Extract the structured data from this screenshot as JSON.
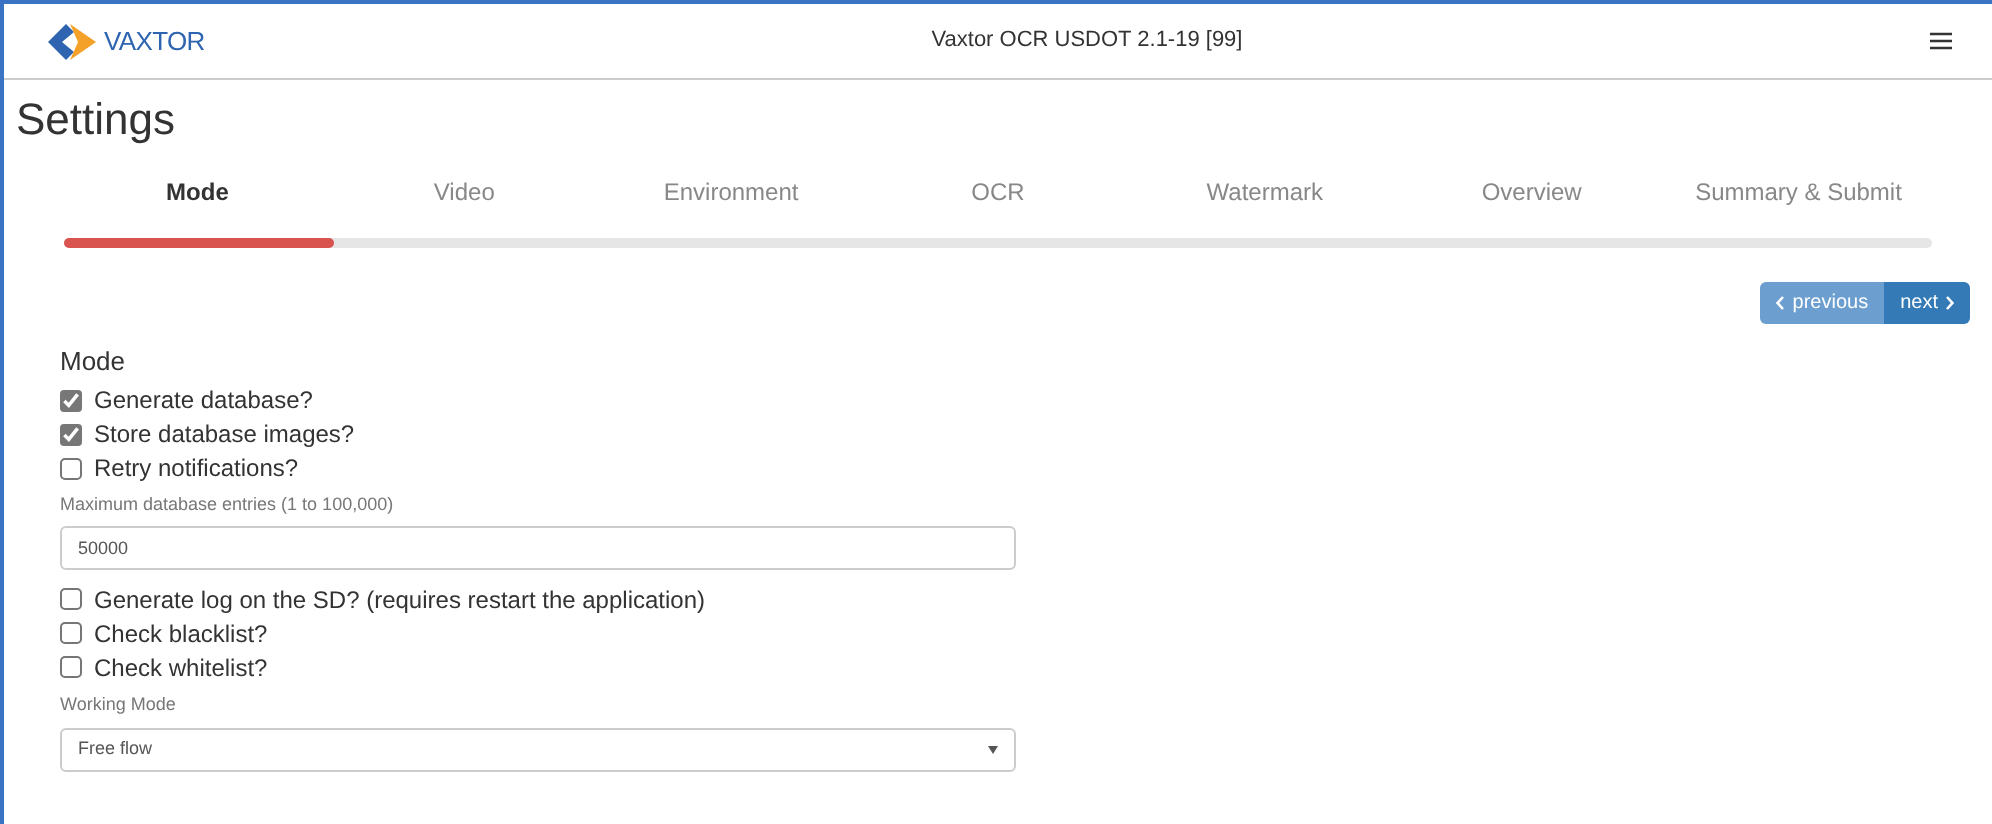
{
  "header": {
    "brand": "VAXTOR",
    "title": "Vaxtor OCR USDOT 2.1-19 [99]"
  },
  "page_title": "Settings",
  "steps": [
    {
      "label": "Mode",
      "selected": true
    },
    {
      "label": "Video",
      "selected": false
    },
    {
      "label": "Environment",
      "selected": false
    },
    {
      "label": "OCR",
      "selected": false
    },
    {
      "label": "Watermark",
      "selected": false
    },
    {
      "label": "Overview",
      "selected": false
    },
    {
      "label": "Summary & Submit",
      "selected": false
    }
  ],
  "progress": {
    "level": 0.145
  },
  "nav": {
    "previous": {
      "label": "previous",
      "disabled": true
    },
    "next": {
      "label": "next",
      "disabled": false
    }
  },
  "section": "Mode",
  "fields": [
    {
      "kind": "checkbox",
      "label": "Generate database?",
      "checked": true
    },
    {
      "kind": "checkbox",
      "label": "Store database images?",
      "checked": true
    },
    {
      "kind": "checkbox",
      "label": "Retry notifications?",
      "checked": false
    },
    {
      "kind": "input",
      "label": "Maximum database entries (1 to 100,000)",
      "value": "50000"
    },
    {
      "kind": "checkbox",
      "label": "Generate log on the SD? (requires restart the application)",
      "checked": false
    },
    {
      "kind": "checkbox",
      "label": "Check blacklist?",
      "checked": false
    },
    {
      "kind": "checkbox",
      "label": "Check whitelist?",
      "checked": false
    },
    {
      "kind": "select",
      "label": "Working Mode",
      "value": "Free flow"
    }
  ]
}
